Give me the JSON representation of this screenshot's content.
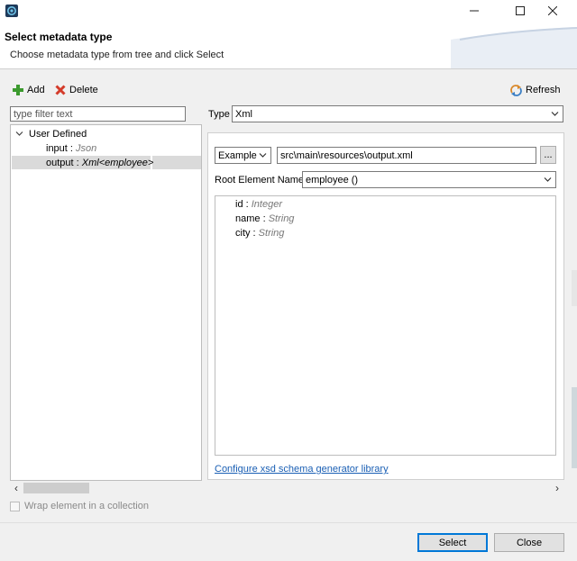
{
  "window": {
    "minimize_icon": "minimize-icon",
    "maximize_icon": "maximize-icon",
    "close_icon": "close-icon"
  },
  "header": {
    "title": "Select metadata type",
    "subtitle": "Choose metadata type from tree and click Select"
  },
  "toolbar": {
    "add_label": "Add",
    "delete_label": "Delete",
    "refresh_label": "Refresh"
  },
  "filter": {
    "placeholder": "type filter text"
  },
  "tree": {
    "root_label": "User Defined",
    "items": [
      {
        "name": "input : ",
        "type": "Json"
      },
      {
        "name": "output : ",
        "type": "Xml<employee>"
      }
    ]
  },
  "type_select": {
    "label": "Type",
    "value": "Xml"
  },
  "source": {
    "mode": "Example",
    "path": "src\\main\\resources\\output.xml",
    "browse_label": "..."
  },
  "root_element": {
    "label": "Root Element Name",
    "value": "employee ()"
  },
  "schema": {
    "fields": [
      {
        "name": "id : ",
        "type": "Integer"
      },
      {
        "name": "name : ",
        "type": "String"
      },
      {
        "name": "city : ",
        "type": "String"
      }
    ]
  },
  "link_label": "Configure xsd schema generator library",
  "wrap_label": "Wrap element in a collection",
  "buttons": {
    "select": "Select",
    "close": "Close"
  },
  "colors": {
    "link": "#1a5fb4",
    "add_icon": "#3c9a2e",
    "delete_icon": "#d43b2a",
    "default_button_border": "#0078d7"
  }
}
